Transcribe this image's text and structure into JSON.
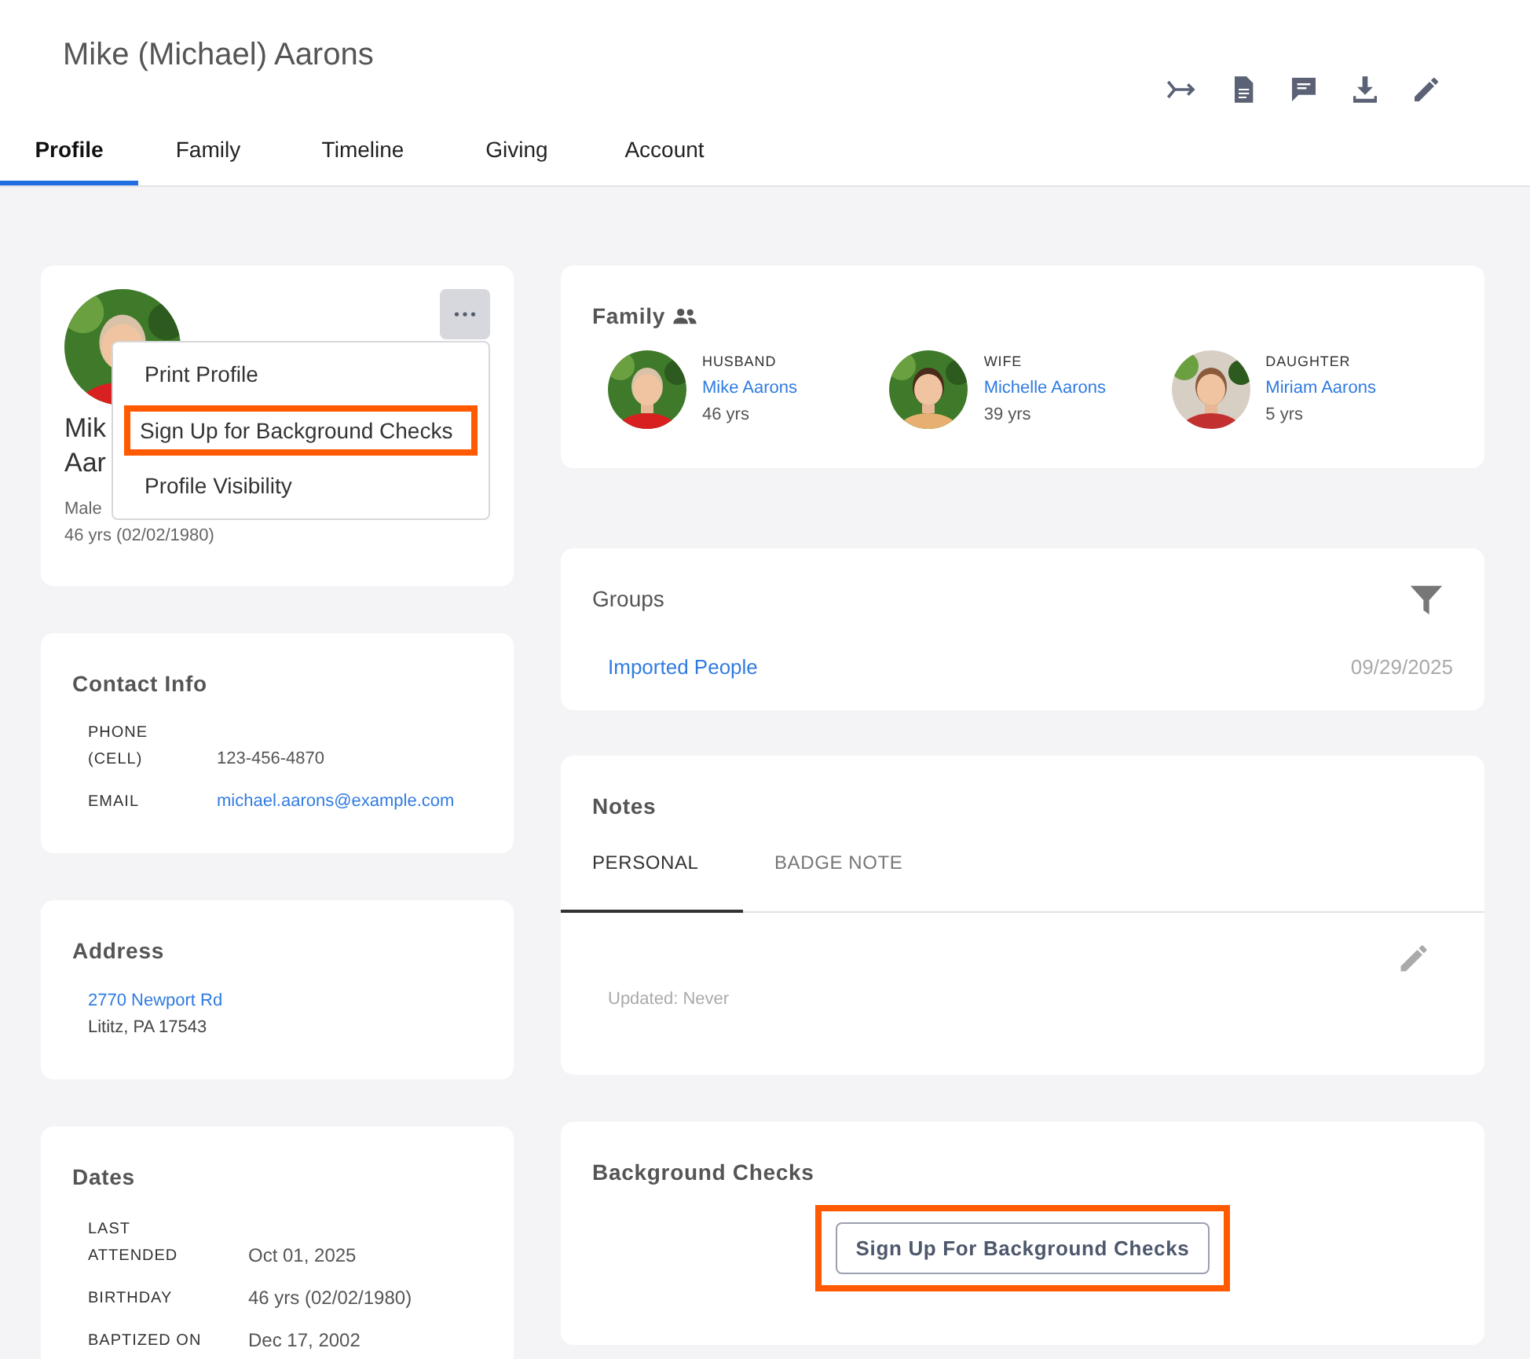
{
  "header": {
    "title": "Mike (Michael) Aarons"
  },
  "tabs": [
    {
      "label": "Profile",
      "selected": true
    },
    {
      "label": "Family",
      "selected": false
    },
    {
      "label": "Timeline",
      "selected": false
    },
    {
      "label": "Giving",
      "selected": false
    },
    {
      "label": "Account",
      "selected": false
    }
  ],
  "profile_card": {
    "avatar": {
      "kind": "picture"
    },
    "name_lines": [
      "Mik",
      "Aar"
    ],
    "gender": "Male",
    "age": "46 yrs (02/02/1980)",
    "menu": [
      {
        "label": "Print Profile",
        "highlighted": false
      },
      {
        "label": "Sign Up for Background Checks",
        "highlighted": true
      },
      {
        "label": "Profile Visibility",
        "highlighted": false
      }
    ]
  },
  "contact_info": {
    "title": "Contact Info",
    "rows": [
      {
        "label": "PHONE (CELL)",
        "value": "123-456-4870",
        "kind": "text"
      },
      {
        "label": "EMAIL",
        "value": "michael.aarons@example.com",
        "kind": "link"
      }
    ]
  },
  "address": {
    "title": "Address",
    "street": "2770 Newport Rd",
    "city": "Lititz, PA 17543"
  },
  "dates": {
    "title": "Dates",
    "rows": [
      {
        "label": "LAST ATTENDED",
        "value": "Oct 01, 2025"
      },
      {
        "label": "BIRTHDAY",
        "value": "46 yrs (02/02/1980)"
      },
      {
        "label": "BAPTIZED ON",
        "value": "Dec 17, 2002"
      }
    ]
  },
  "family": {
    "title": "Family",
    "members": [
      {
        "role": "HUSBAND",
        "name": "Mike Aarons",
        "age": "46 yrs",
        "avatar": {
          "kind": "picture"
        }
      },
      {
        "role": "WIFE",
        "name": "Michelle Aarons",
        "age": "39 yrs",
        "avatar": {
          "kind": "picture"
        }
      },
      {
        "role": "DAUGHTER",
        "name": "Miriam Aarons",
        "age": "5 yrs",
        "avatar": {
          "kind": "picture"
        }
      }
    ]
  },
  "groups": {
    "title": "Groups",
    "items": [
      {
        "name": "Imported People",
        "date": "09/29/2025"
      }
    ]
  },
  "notes": {
    "title": "Notes",
    "tabs": [
      {
        "label": "PERSONAL",
        "selected": true
      },
      {
        "label": "BADGE NOTE",
        "selected": false
      }
    ],
    "updated": "Updated: Never"
  },
  "background_checks": {
    "title": "Background Checks",
    "button": {
      "label": "Sign Up For Background Checks",
      "highlighted": true
    }
  }
}
